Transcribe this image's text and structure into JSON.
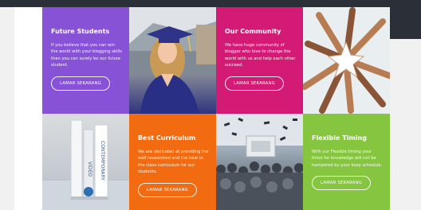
{
  "tiles": [
    {
      "title": "Future Students",
      "description": "If you believe that you can win the world with your blogging skills then you can surely be our future student.",
      "button": "LAMAR SEKARANG",
      "color": "#8752d6"
    },
    {
      "title": "Our Community",
      "description": "We have huge community of blogger who love to change the world with us and help each other succeed.",
      "button": "LAMAR SEKARANG",
      "color": "#d31b76"
    },
    {
      "title": "Best Curriculum",
      "description": "We are dedicated at providing the well researched and the best in the class curriculum for our students.",
      "button": "LAMAR SEKARANG",
      "color": "#f36b10"
    },
    {
      "title": "Flexible Timing",
      "description": "With our Flexible timing your thirst for knowledge will not be hampered by your busy schedule.",
      "button": "LAMAR SEKARANG",
      "color": "#86c53f"
    }
  ],
  "photos": {
    "graduate": "graduate-woman-photo",
    "hands": "hands-star-photo",
    "books": "books-photo",
    "crowd": "graduation-crowd-photo"
  }
}
